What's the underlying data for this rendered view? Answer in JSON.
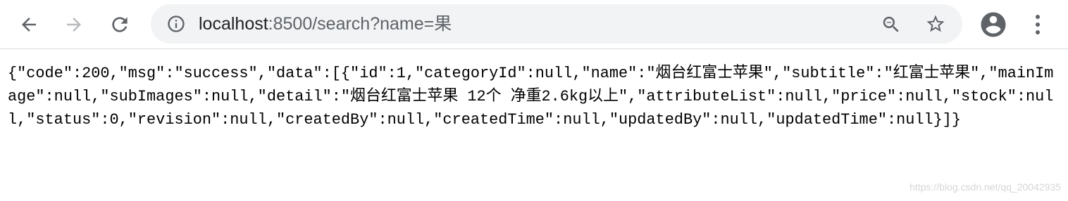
{
  "browser": {
    "back_icon": "arrow-left-icon",
    "forward_icon": "arrow-right-icon",
    "reload_icon": "reload-icon",
    "address_bar": {
      "site_info_icon": "info-circle-icon",
      "url_host": "localhost",
      "url_rest": ":8500/search?name=果",
      "zoom_icon": "zoom-out-icon",
      "bookmark_icon": "star-outline-icon"
    },
    "profile_icon": "account-circle-icon",
    "menu_icon": "vertical-dots-icon",
    "colors": {
      "toolbar_bg": "#ffffff",
      "omnibox_bg": "#f1f3f4",
      "icon": "#5f6368",
      "icon_disabled": "#b9bbbe",
      "avatar": "#5f6368"
    }
  },
  "page": {
    "json_text": "{\"code\":200,\"msg\":\"success\",\"data\":[{\"id\":1,\"categoryId\":null,\"name\":\"烟台红富士苹果\",\"subtitle\":\"红富士苹果\",\"mainImage\":null,\"subImages\":null,\"detail\":\"烟台红富士苹果 12个 净重2.6kg以上\",\"attributeList\":null,\"price\":null,\"stock\":null,\"status\":0,\"revision\":null,\"createdBy\":null,\"createdTime\":null,\"updatedBy\":null,\"updatedTime\":null}]}",
    "watermark": "https://blog.csdn.net/qq_20042935"
  }
}
